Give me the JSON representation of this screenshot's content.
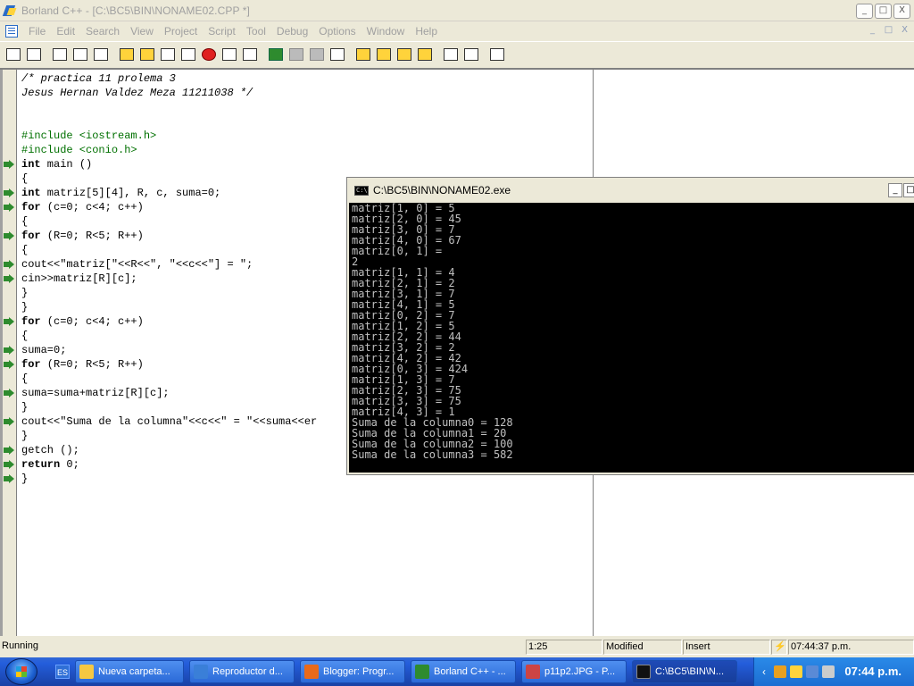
{
  "window": {
    "title": "Borland C++ - [C:\\BC5\\BIN\\NONAME02.CPP *]",
    "controls": [
      "_",
      "□",
      "X"
    ]
  },
  "menu": {
    "items": [
      "File",
      "Edit",
      "Search",
      "View",
      "Project",
      "Script",
      "Tool",
      "Debug",
      "Options",
      "Window",
      "Help"
    ],
    "mdi_controls": [
      "_",
      "□",
      "X"
    ]
  },
  "toolbar": {
    "icons": [
      "new-file-icon",
      "open-file-icon",
      "save-file-icon",
      "save-all-icon",
      "print-icon",
      "copy-icon",
      "make-icon",
      "compile-icon",
      "run-icon",
      "step-icon",
      "trace-icon",
      "stop-icon",
      "breakpoint-icon",
      "reset-icon",
      "undo-icon",
      "cut-icon",
      "copy2-icon",
      "paste-icon",
      "find-icon",
      "replace-icon",
      "find-next-icon",
      "browse-icon",
      "window-icon",
      "tile-icon",
      "help-icon"
    ]
  },
  "editor": {
    "lines": [
      {
        "text": "/* practica 11 prolema 3",
        "style": "cm",
        "mark": false
      },
      {
        "text": "Jesus Hernan Valdez Meza 11211038 */",
        "style": "cm",
        "mark": false
      },
      {
        "text": "",
        "style": "",
        "mark": false
      },
      {
        "text": "",
        "style": "",
        "mark": false
      },
      {
        "text": "#include <iostream.h>",
        "style": "pp",
        "mark": false
      },
      {
        "text": "#include <conio.h>",
        "style": "pp",
        "mark": false
      },
      {
        "text": "int main ()",
        "style": "kwl",
        "kw": "int",
        "mark": true
      },
      {
        "text": "{",
        "style": "",
        "mark": false
      },
      {
        "text": "int matriz[5][4], R, c, suma=0;",
        "style": "kwl",
        "kw": "int",
        "mark": true
      },
      {
        "text": "for (c=0; c<4; c++)",
        "style": "kwl",
        "kw": "for",
        "mark": true
      },
      {
        "text": "{",
        "style": "",
        "mark": false
      },
      {
        "text": "for (R=0; R<5; R++)",
        "style": "kwl",
        "kw": "for",
        "mark": true
      },
      {
        "text": "{",
        "style": "",
        "mark": false
      },
      {
        "text": "cout<<\"matriz[\"<<R<<\", \"<<c<<\"] = \";",
        "style": "",
        "mark": true
      },
      {
        "text": "cin>>matriz[R][c];",
        "style": "",
        "mark": true
      },
      {
        "text": "}",
        "style": "",
        "mark": false
      },
      {
        "text": "}",
        "style": "",
        "mark": false
      },
      {
        "text": "for (c=0; c<4; c++)",
        "style": "kwl",
        "kw": "for",
        "mark": true
      },
      {
        "text": "{",
        "style": "",
        "mark": false
      },
      {
        "text": "suma=0;",
        "style": "",
        "mark": true
      },
      {
        "text": "for (R=0; R<5; R++)",
        "style": "kwl",
        "kw": "for",
        "mark": true
      },
      {
        "text": "{",
        "style": "",
        "mark": false
      },
      {
        "text": "suma=suma+matriz[R][c];",
        "style": "",
        "mark": true
      },
      {
        "text": "}",
        "style": "",
        "mark": false
      },
      {
        "text": "cout<<\"Suma de la columna\"<<c<<\" = \"<<suma<<er",
        "style": "",
        "mark": true
      },
      {
        "text": "}",
        "style": "",
        "mark": false
      },
      {
        "text": "getch ();",
        "style": "",
        "mark": true
      },
      {
        "text": "return 0;",
        "style": "kwl",
        "kw": "return",
        "mark": true
      },
      {
        "text": "}",
        "style": "",
        "mark": true
      }
    ]
  },
  "console": {
    "title": "C:\\BC5\\BIN\\NONAME02.exe",
    "icon_label": "C:\\",
    "controls": [
      "_",
      "□"
    ],
    "lines": [
      "matriz[1, 0] = 5",
      "matriz[2, 0] = 45",
      "matriz[3, 0] = 7",
      "matriz[4, 0] = 67",
      "matriz[0, 1] =",
      "2",
      "matriz[1, 1] = 4",
      "matriz[2, 1] = 2",
      "matriz[3, 1] = 7",
      "matriz[4, 1] = 5",
      "matriz[0, 2] = 7",
      "matriz[1, 2] = 5",
      "matriz[2, 2] = 44",
      "matriz[3, 2] = 2",
      "matriz[4, 2] = 42",
      "matriz[0, 3] = 424",
      "matriz[1, 3] = 7",
      "matriz[2, 3] = 75",
      "matriz[3, 3] = 75",
      "matriz[4, 3] = 1",
      "Suma de la columna0 = 128",
      "Suma de la columna1 = 20",
      "Suma de la columna2 = 100",
      "Suma de la columna3 = 582"
    ]
  },
  "status": {
    "state": "Running",
    "position": "1:25",
    "modified": "Modified",
    "mode": "Insert",
    "time": "07:44:37 p.m."
  },
  "taskbar": {
    "lang": "ES",
    "tasks": [
      {
        "label": "Nueva carpeta...",
        "color": "#f5c842"
      },
      {
        "label": "Reproductor d...",
        "color": "#3a7fd8"
      },
      {
        "label": "Blogger: Progr...",
        "color": "#e86a1a"
      },
      {
        "label": "Borland C++ - ...",
        "color": "#2e8b2e"
      },
      {
        "label": "p11p2.JPG - P...",
        "color": "#c44"
      },
      {
        "label": "C:\\BC5\\BIN\\N...",
        "color": "#111"
      }
    ],
    "clock": "07:44 p.m."
  },
  "colors": {
    "preprocessor": "#007000",
    "console_bg": "#000000",
    "console_fg": "#c0c0c0",
    "taskbar": "#245edc"
  }
}
